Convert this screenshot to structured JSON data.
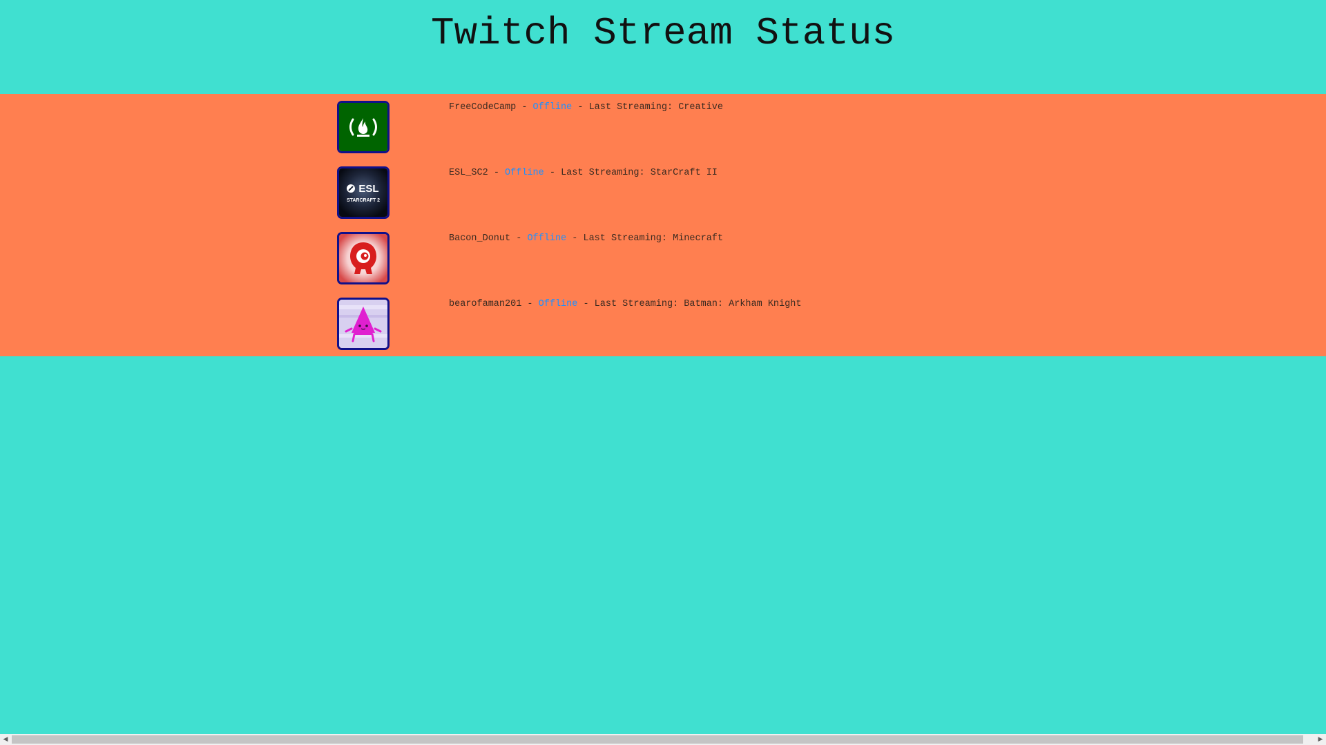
{
  "page": {
    "title": "Twitch Stream Status"
  },
  "colors": {
    "background": "#40e0d0",
    "band": "#ff7f50",
    "status_offline": "#1e90ff",
    "avatar_border": "#10108a"
  },
  "streams": [
    {
      "name": "FreeCodeCamp",
      "separator1": " - ",
      "status": "Offline",
      "separator2": " - ",
      "last_label": "Last Streaming: ",
      "last_game": "Creative",
      "icon": "freecodecamp-logo-icon"
    },
    {
      "name": "ESL_SC2",
      "separator1": " - ",
      "status": "Offline",
      "separator2": " - ",
      "last_label": "Last Streaming: ",
      "last_game": "StarCraft II",
      "icon": "esl-starcraft-logo-icon",
      "logo_text_1": "ESL",
      "logo_text_2": "STARCRAFT 2"
    },
    {
      "name": "Bacon_Donut",
      "separator1": " - ",
      "status": "Offline",
      "separator2": " - ",
      "last_label": "Last Streaming: ",
      "last_game": "Minecraft",
      "icon": "bacon-donut-logo-icon"
    },
    {
      "name": "bearofaman201",
      "separator1": " - ",
      "status": "Offline",
      "separator2": " - ",
      "last_label": "Last Streaming: ",
      "last_game": "Batman: Arkham Knight",
      "icon": "bearofaman-avatar-icon"
    }
  ]
}
